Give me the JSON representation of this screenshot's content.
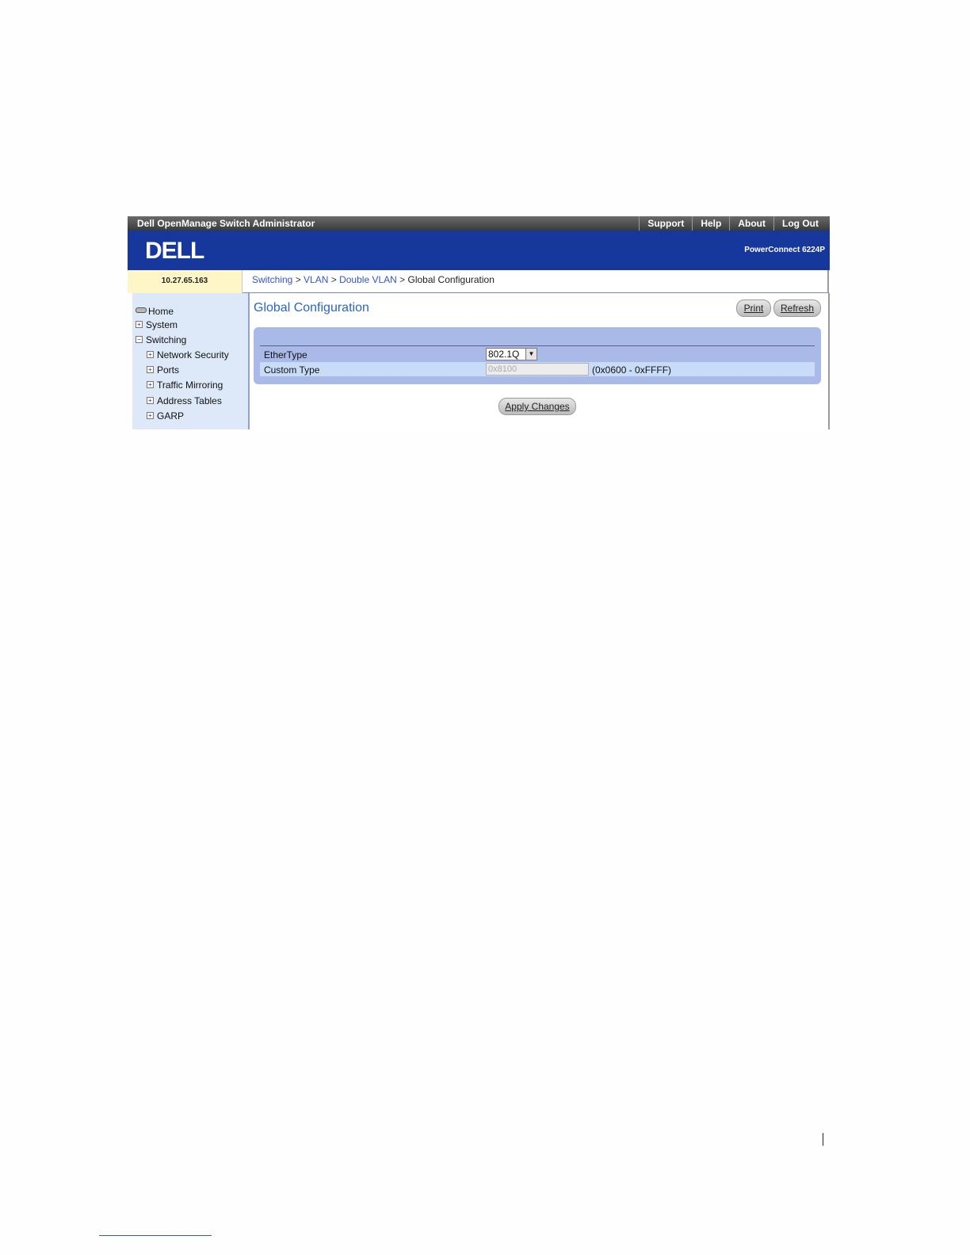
{
  "app": {
    "title": "Dell OpenManage Switch Administrator",
    "top_links": [
      "Support",
      "Help",
      "About",
      "Log Out"
    ],
    "logo": "DELL",
    "product": "PowerConnect 6224P",
    "ip": "10.27.65.163"
  },
  "breadcrumb": {
    "links": [
      "Switching",
      "VLAN",
      "Double VLAN"
    ],
    "current": "Global Configuration",
    "separator": ">"
  },
  "sidebar": {
    "items": [
      {
        "label": "Home",
        "icon": "home-icon"
      },
      {
        "label": "System",
        "icon": "expand-icon"
      },
      {
        "label": "Switching",
        "icon": "collapse-icon"
      },
      {
        "label": "Network Security",
        "icon": "expand-icon"
      },
      {
        "label": "Ports",
        "icon": "expand-icon"
      },
      {
        "label": "Traffic Mirroring",
        "icon": "expand-icon"
      },
      {
        "label": "Address Tables",
        "icon": "expand-icon"
      },
      {
        "label": "GARP",
        "icon": "expand-icon"
      }
    ]
  },
  "main": {
    "title": "Global Configuration",
    "print_label": "Print",
    "refresh_label": "Refresh",
    "ethertype_label": "EtherType",
    "ethertype_value": "802.1Q",
    "custom_type_label": "Custom Type",
    "custom_type_value": "0x8100",
    "custom_type_range": "(0x0600 - 0xFFFF)",
    "apply_label": "Apply Changes"
  },
  "colors": {
    "banner": "#16389c",
    "title_blue": "#2a64c8",
    "panel": "#a9b9e8",
    "sidebar": "#dde9f8",
    "ip_cell": "#fff6c8"
  }
}
